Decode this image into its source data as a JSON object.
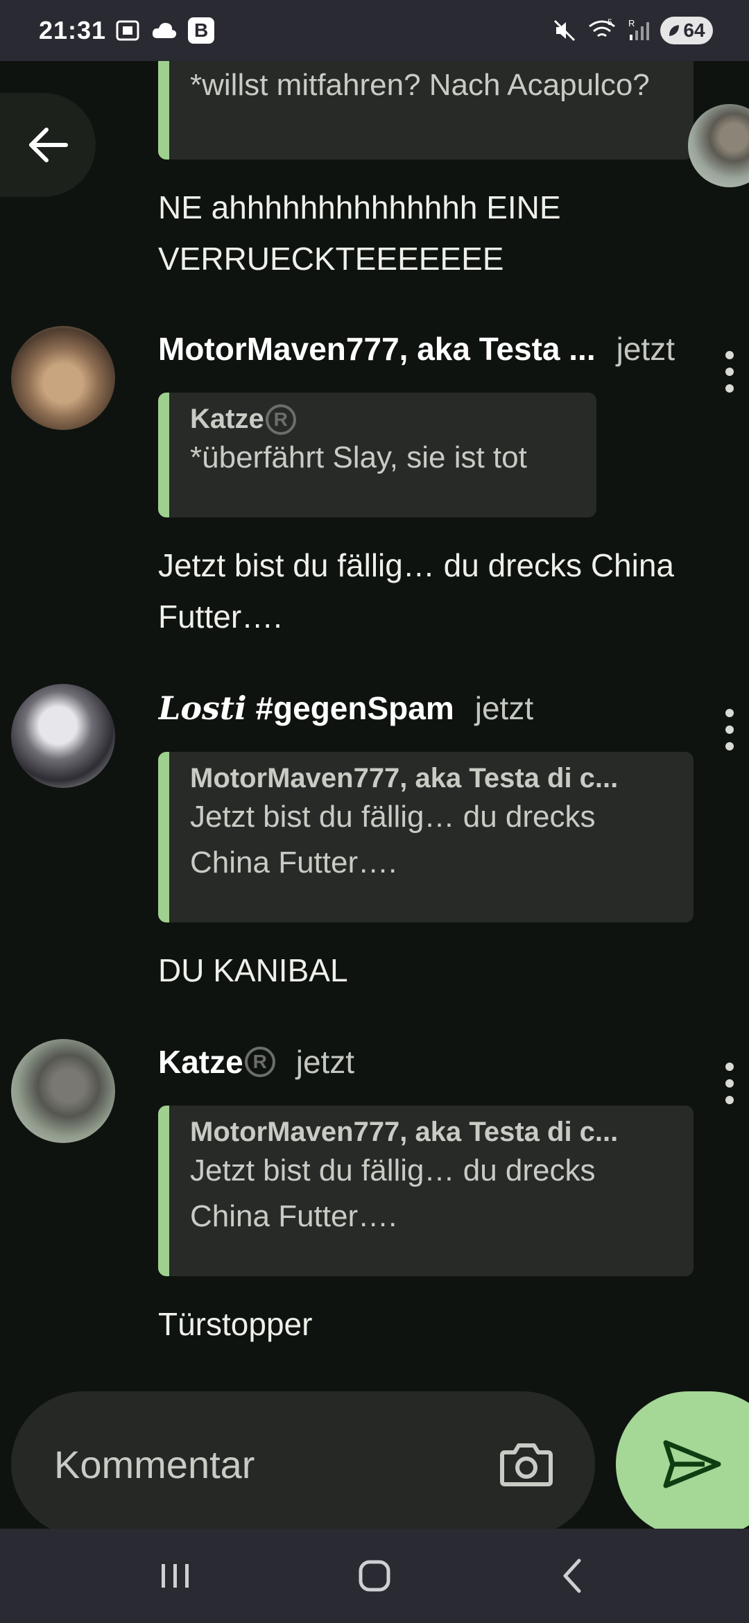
{
  "status_bar": {
    "time": "21:31",
    "b_label": "B",
    "battery": "64",
    "network_badge": "5",
    "roaming": "R"
  },
  "messages": [
    {
      "quote_text": "*willst mitfahren? Nach Acapulco?",
      "text": "NE ahhhhhhhhhhhhhh EINE VERRUECKTEEEEEEE"
    },
    {
      "author": "MotorMaven777, aka Testa ...",
      "time": "jetzt",
      "quote_author": "Katze",
      "quote_text": "*überfährt Slay, sie ist tot",
      "text": "Jetzt bist du fällig… du drecks China Futter…."
    },
    {
      "author_part1": "Losti",
      "author_part2": "#gegenSpam",
      "time": "jetzt",
      "quote_author": "MotorMaven777, aka Testa di c...",
      "quote_text": "Jetzt bist du fällig… du drecks China Futter….",
      "text": "DU KANIBAL"
    },
    {
      "author": "Katze",
      "time": "jetzt",
      "quote_author": "MotorMaven777, aka Testa di c...",
      "quote_text": "Jetzt bist du fällig… du drecks China Futter….",
      "text": "Türstopper"
    }
  ],
  "reg_mark": "R",
  "composer": {
    "placeholder": "Kommentar"
  },
  "icons": {
    "back": "arrow-left-icon",
    "camera": "camera-icon",
    "send": "send-icon",
    "more": "more-vertical-icon",
    "nav_recents": "recents-icon",
    "nav_home": "home-icon",
    "nav_back": "nav-back-icon"
  },
  "colors": {
    "background": "#0f130f",
    "accent_green": "#a5d796",
    "quote_bar": "#9fd08f",
    "bubble": "#272a26"
  }
}
